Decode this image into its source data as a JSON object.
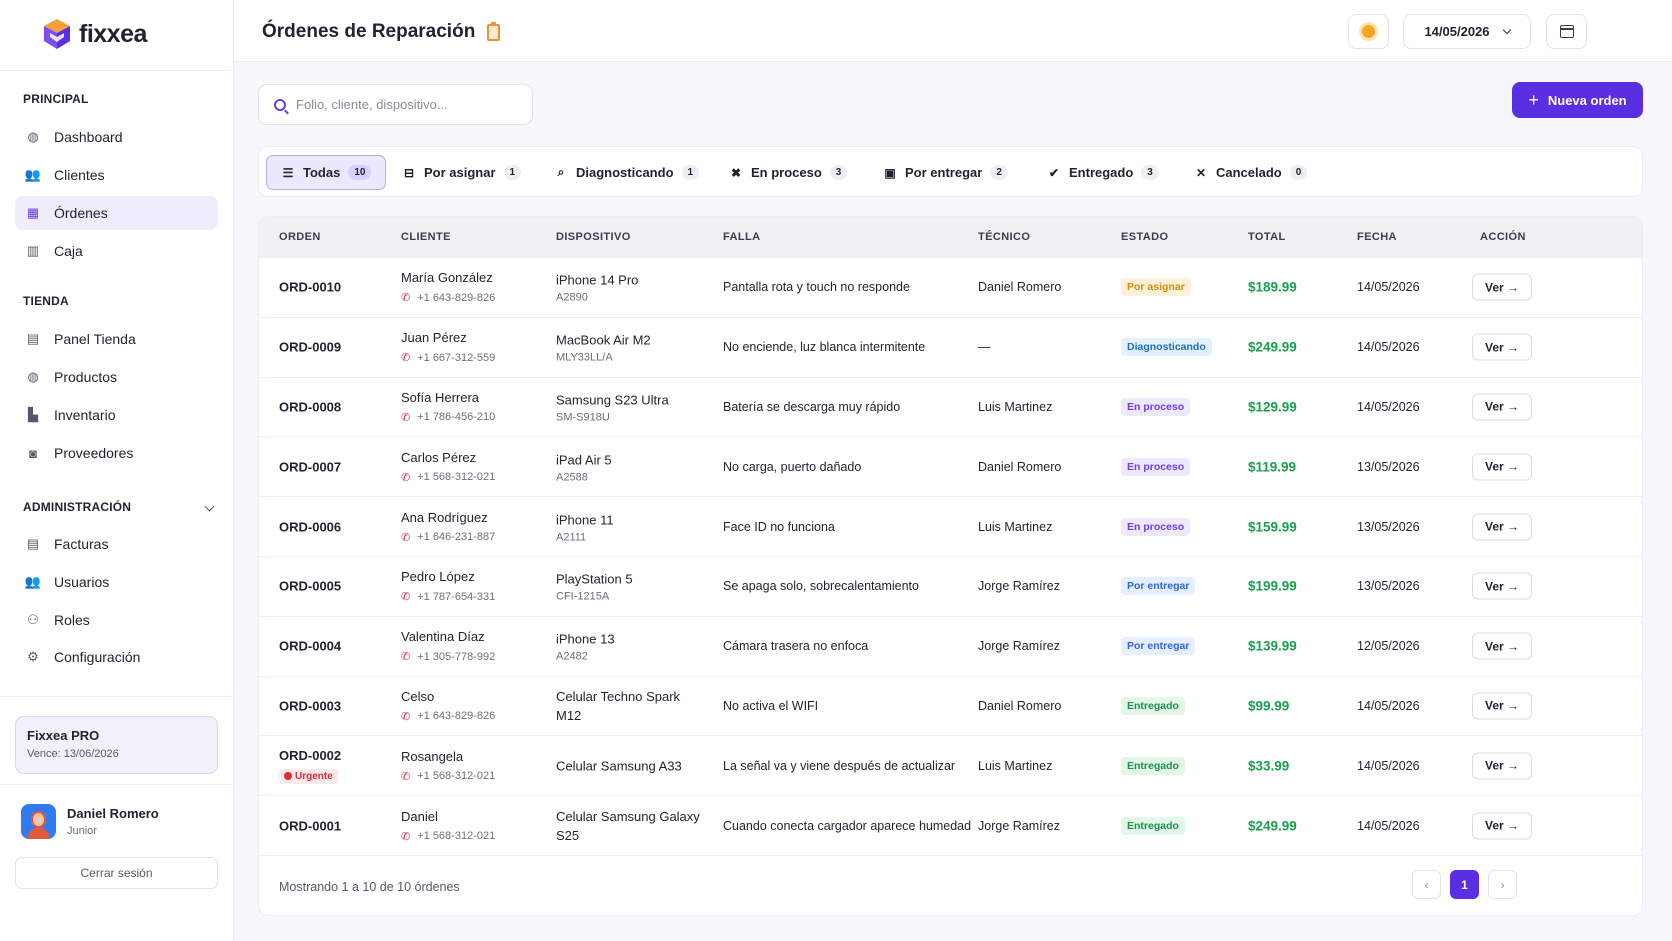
{
  "app": {
    "name": "fixxea"
  },
  "sidebar": {
    "sections": [
      {
        "title": "PRINCIPAL",
        "items": [
          {
            "label": "Dashboard",
            "icon": "dashboard-icon",
            "glyph": "◍",
            "active": false
          },
          {
            "label": "Clientes",
            "icon": "clients-icon",
            "glyph": "👥",
            "active": false
          },
          {
            "label": "Órdenes",
            "icon": "orders-icon",
            "glyph": "▦",
            "active": true
          },
          {
            "label": "Caja",
            "icon": "cash-register-icon",
            "glyph": "▥",
            "active": false
          }
        ]
      },
      {
        "title": "TIENDA",
        "items": [
          {
            "label": "Panel Tienda",
            "icon": "store-panel-icon",
            "glyph": "▤",
            "active": false
          },
          {
            "label": "Productos",
            "icon": "products-icon",
            "glyph": "◍",
            "active": false
          },
          {
            "label": "Inventario",
            "icon": "inventory-icon",
            "glyph": "▙",
            "active": false
          },
          {
            "label": "Proveedores",
            "icon": "suppliers-icon",
            "glyph": "◙",
            "active": false
          }
        ]
      },
      {
        "title": "ADMINISTRACIÓN",
        "items": [
          {
            "label": "Facturas",
            "icon": "invoices-icon",
            "glyph": "▤",
            "active": false
          },
          {
            "label": "Usuarios",
            "icon": "users-icon",
            "glyph": "👥",
            "active": false
          },
          {
            "label": "Roles",
            "icon": "roles-icon",
            "glyph": "⚇",
            "active": false
          },
          {
            "label": "Configuración",
            "icon": "settings-gear-icon",
            "glyph": "⚙",
            "active": false
          }
        ]
      }
    ],
    "plan": {
      "title": "Fixxea PRO",
      "expires": "Vence: 13/06/2026"
    },
    "user": {
      "name": "Daniel Romero",
      "role": "Junior"
    },
    "logout_label": "Cerrar sesión"
  },
  "header": {
    "title": "Órdenes de Reparación",
    "date": "14/05/2026"
  },
  "search": {
    "placeholder": "Folio, cliente, dispositivo...",
    "value": ""
  },
  "new_order_label": "Nueva orden",
  "tabs": [
    {
      "label": "Todas",
      "count": "10",
      "icon": "list-icon",
      "glyph": "☰",
      "active": true
    },
    {
      "label": "Por asignar",
      "count": "1",
      "icon": "inbox-icon",
      "glyph": "⊟",
      "active": false
    },
    {
      "label": "Diagnosticando",
      "count": "1",
      "icon": "search-icon",
      "glyph": "⌕",
      "active": false
    },
    {
      "label": "En proceso",
      "count": "3",
      "icon": "tools-icon",
      "glyph": "✖",
      "active": false
    },
    {
      "label": "Por entregar",
      "count": "2",
      "icon": "package-icon",
      "glyph": "▣",
      "active": false
    },
    {
      "label": "Entregado",
      "count": "3",
      "icon": "check-circle-icon",
      "glyph": "✔",
      "active": false
    },
    {
      "label": "Cancelado",
      "count": "0",
      "icon": "x-icon",
      "glyph": "✕",
      "active": false
    }
  ],
  "table": {
    "columns": [
      "ORDEN",
      "CLIENTE",
      "DISPOSITIVO",
      "FALLA",
      "TÉCNICO",
      "ESTADO",
      "TOTAL",
      "FECHA",
      "ACCIÓN"
    ],
    "rows": [
      {
        "id": "ORD-0010",
        "urgent": "",
        "client": "María González",
        "phone": "+1 643-829-826",
        "device": "iPhone 14 Pro",
        "model": "A2890",
        "fault": "Pantalla rota y touch no responde",
        "tech": "Daniel Romero",
        "status": "Por asignar",
        "status_key": "assign",
        "total": "$189.99",
        "date": "14/05/2026",
        "action": "Ver →"
      },
      {
        "id": "ORD-0009",
        "urgent": "",
        "client": "Juan Pérez",
        "phone": "+1 667-312-559",
        "device": "MacBook Air M2",
        "model": "MLY33LL/A",
        "fault": "No enciende, luz blanca intermitente",
        "tech": "—",
        "status": "Diagnosticando",
        "status_key": "diag",
        "total": "$249.99",
        "date": "14/05/2026",
        "action": "Ver →"
      },
      {
        "id": "ORD-0008",
        "urgent": "",
        "client": "Sofía Herrera",
        "phone": "+1 786-456-210",
        "device": "Samsung S23 Ultra",
        "model": "SM-S918U",
        "fault": "Batería se descarga muy rápido",
        "tech": "Luis Martinez",
        "status": "En proceso",
        "status_key": "proc",
        "total": "$129.99",
        "date": "14/05/2026",
        "action": "Ver →"
      },
      {
        "id": "ORD-0007",
        "urgent": "",
        "client": "Carlos Pérez",
        "phone": "+1 568-312-021",
        "device": "iPad Air 5",
        "model": "A2588",
        "fault": "No carga, puerto dañado",
        "tech": "Daniel Romero",
        "status": "En proceso",
        "status_key": "proc",
        "total": "$119.99",
        "date": "13/05/2026",
        "action": "Ver →"
      },
      {
        "id": "ORD-0006",
        "urgent": "",
        "client": "Ana Rodríguez",
        "phone": "+1 646-231-887",
        "device": "iPhone 11",
        "model": "A2111",
        "fault": "Face ID no funciona",
        "tech": "Luis Martinez",
        "status": "En proceso",
        "status_key": "proc",
        "total": "$159.99",
        "date": "13/05/2026",
        "action": "Ver →"
      },
      {
        "id": "ORD-0005",
        "urgent": "",
        "client": "Pedro López",
        "phone": "+1 787-654-331",
        "device": "PlayStation 5",
        "model": "CFI-1215A",
        "fault": "Se apaga solo, sobrecalentamiento",
        "tech": "Jorge Ramírez",
        "status": "Por entregar",
        "status_key": "deliver",
        "total": "$199.99",
        "date": "13/05/2026",
        "action": "Ver →"
      },
      {
        "id": "ORD-0004",
        "urgent": "",
        "client": "Valentina Díaz",
        "phone": "+1 305-778-992",
        "device": "iPhone 13",
        "model": "A2482",
        "fault": "Cámara trasera no enfoca",
        "tech": "Jorge Ramírez",
        "status": "Por entregar",
        "status_key": "deliver",
        "total": "$139.99",
        "date": "12/05/2026",
        "action": "Ver →"
      },
      {
        "id": "ORD-0003",
        "urgent": "",
        "client": "Celso",
        "phone": "+1 643-829-826",
        "device": "Celular Techno Spark M12",
        "model": "",
        "fault": "No activa el WIFI",
        "tech": "Daniel Romero",
        "status": "Entregado",
        "status_key": "done",
        "total": "$99.99",
        "date": "14/05/2026",
        "action": "Ver →"
      },
      {
        "id": "ORD-0002",
        "urgent": "Urgente",
        "client": "Rosangela",
        "phone": "+1 568-312-021",
        "device": "Celular Samsung A33",
        "model": "",
        "fault": "La señal va y viene después de actualizar",
        "tech": "Luis Martinez",
        "status": "Entregado",
        "status_key": "done",
        "total": "$33.99",
        "date": "14/05/2026",
        "action": "Ver →"
      },
      {
        "id": "ORD-0001",
        "urgent": "",
        "client": "Daniel",
        "phone": "+1 568-312-021",
        "device": "Celular Samsung Galaxy S25",
        "model": "",
        "fault": "Cuando conecta cargador aparece humedad",
        "tech": "Jorge Ramírez",
        "status": "Entregado",
        "status_key": "done",
        "total": "$249.99",
        "date": "14/05/2026",
        "action": "Ver →"
      }
    ]
  },
  "status_colors": {
    "assign": {
      "bg": "#fdf1d9",
      "fg": "#d98a0b"
    },
    "diag": {
      "bg": "#e3f1fc",
      "fg": "#1f6fc4"
    },
    "proc": {
      "bg": "#efe9fd",
      "fg": "#6d3ef0"
    },
    "deliver": {
      "bg": "#e6efff",
      "fg": "#2f63e0"
    },
    "done": {
      "bg": "#e3f6e9",
      "fg": "#18934a"
    }
  },
  "footer": {
    "summary": "Mostrando 1 a 10 de 10 órdenes",
    "pages": [
      "1"
    ],
    "current_page": "1"
  },
  "colors": {
    "accent": "#5a2fe3",
    "total": "#18a14c",
    "urgent": "#d92d3a"
  }
}
